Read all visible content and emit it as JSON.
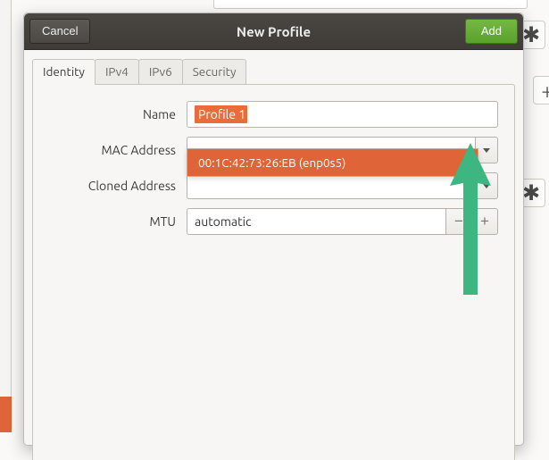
{
  "colors": {
    "accent_orange": "#df6437",
    "accent_green": "#5aa22c"
  },
  "header": {
    "cancel_label": "Cancel",
    "title": "New Profile",
    "add_label": "Add"
  },
  "tabs": {
    "identity": "Identity",
    "ipv4": "IPv4",
    "ipv6": "IPv6",
    "security": "Security"
  },
  "form": {
    "name_label": "Name",
    "name_value": "Profile 1",
    "mac_label": "MAC Address",
    "mac_value": "",
    "cloned_label": "Cloned Address",
    "cloned_value": "",
    "mtu_label": "MTU",
    "mtu_value": "automatic"
  },
  "mac_dropdown": {
    "options": [
      "00:1C:42:73:26:EB (enp0s5)"
    ]
  },
  "annotation": {
    "arrow_color": "#3db681"
  }
}
